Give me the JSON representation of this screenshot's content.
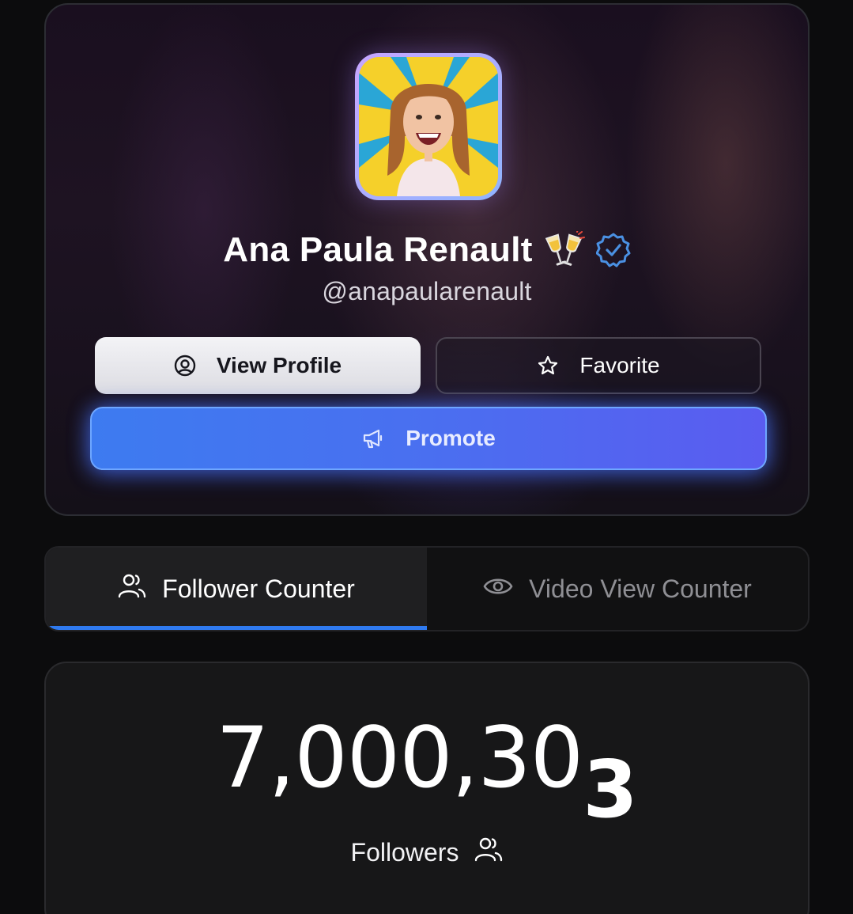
{
  "profile": {
    "name": "Ana Paula Renault",
    "name_emoji": "clinking-glasses",
    "verified": true,
    "handle": "@anapaularenault",
    "avatar_icon": "profile-photo"
  },
  "actions": {
    "view_profile_label": "View Profile",
    "favorite_label": "Favorite",
    "promote_label": "Promote"
  },
  "tabs": [
    {
      "label": "Follower Counter",
      "icon": "users-icon",
      "active": true
    },
    {
      "label": "Video View Counter",
      "icon": "eye-icon",
      "active": false
    }
  ],
  "counter": {
    "digits_main": "7,000,30",
    "digit_last": "3",
    "label": "Followers"
  },
  "colors": {
    "accent_blue": "#2f7af0",
    "promote_start": "#3d7bf0",
    "promote_end": "#5a5cf0",
    "verified_blue": "#4a90e2"
  }
}
